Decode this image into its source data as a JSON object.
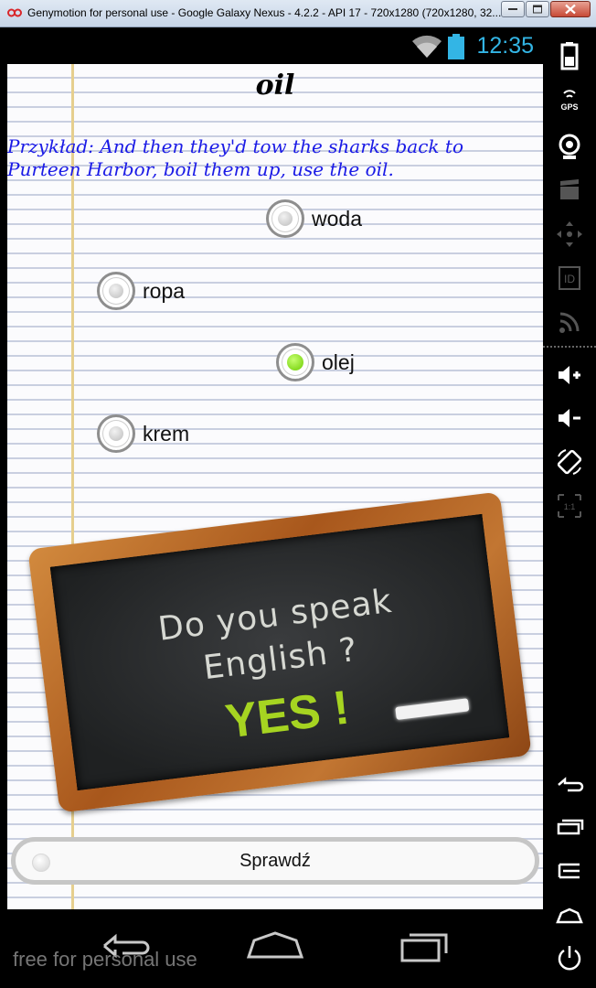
{
  "window": {
    "title": "Genymotion for personal use - Google Galaxy Nexus - 4.2.2 - API 17 - 720x1280 (720x1280, 32..."
  },
  "statusbar": {
    "clock": "12:35",
    "clock_color": "#33b5e5"
  },
  "quiz": {
    "word": "oil",
    "example": "Przykład: And then they'd tow the sharks back to Purteen Harbor, boil them up, use the oil.",
    "example_color": "#1a1ae6",
    "options": [
      {
        "label": "woda",
        "checked": false
      },
      {
        "label": "ropa",
        "checked": false
      },
      {
        "label": "olej",
        "checked": true
      },
      {
        "label": "krem",
        "checked": false
      }
    ],
    "selected_color": "#7ed321"
  },
  "chalkboard": {
    "line1": "Do you speak",
    "line2": "English ?",
    "yes": "YES !",
    "yes_color": "#a6d421"
  },
  "check_button": {
    "label": "Sprawdź"
  },
  "navbar": {
    "watermark": "free for personal use",
    "buttons": [
      "back-icon",
      "home-icon",
      "recent-apps-icon"
    ]
  },
  "sidepanel": {
    "icons": [
      "battery-icon",
      "gps-icon",
      "camera-icon",
      "video-icon",
      "dpad-icon",
      "id-icon",
      "rss-icon",
      "volume-up-icon",
      "volume-down-icon",
      "rotate-icon",
      "scale-icon",
      "back-icon",
      "recent-apps-icon",
      "menu-icon",
      "home-icon",
      "power-icon"
    ],
    "gps_label": "GPS",
    "id_label": "ID",
    "scale_label": "1:1"
  }
}
